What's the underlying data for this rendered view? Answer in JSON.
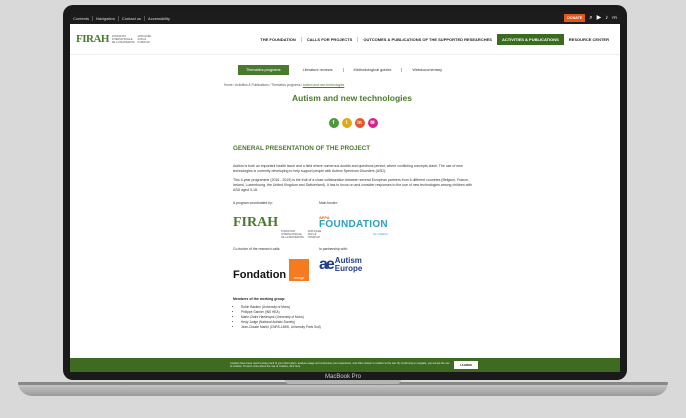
{
  "topbar": {
    "links": [
      "Contents",
      "Navigation",
      "Contact us",
      "Accessibility"
    ],
    "donate": "DONATE",
    "lang": "FR"
  },
  "logo": {
    "mark": "FIRAH",
    "line1": [
      "FONDATION",
      "INTERNATIONALE",
      "DE LA RECHERCHE"
    ],
    "line2": [
      "APPLIQUÉE",
      "SUR LE",
      "HANDICAP"
    ]
  },
  "mainnav": [
    "THE FOUNDATION",
    "CALLS FOR PROJECTS",
    "OUTCOMES & PUBLICATIONS OF THE SUPPORTED RESEARCHES",
    "ACTIVITIES & PUBLICATIONS",
    "RESOURCE CENTER"
  ],
  "subnav": [
    "Thematics programs",
    "Literature reviews",
    "Methodological guides",
    "Webdocumentary"
  ],
  "breadcrumb": {
    "path": "Home / Activities & Publications / Thematics programs / ",
    "current": "Autism and new technologies"
  },
  "title": "Autism and new technologies",
  "share": [
    "f",
    "t",
    "in",
    "✉"
  ],
  "colors": {
    "accent": "#4a7a2e",
    "facebook": "#4c9a3a",
    "twitter": "#e0a81c",
    "linkedin": "#e05a2a",
    "mail": "#d0288a"
  },
  "content": {
    "heading": "GENERAL PRESENTATION OF THE PROJECT",
    "p1": "Autism is both an important health issue and a field where numerous doubts and questions persist, where conflicting concepts clash. The use of new technologies is currently developing to help support people with Autism Spectrum Disorders (ASD).",
    "p2": "This 4-year programme (2016 - 2019) is the fruit of a close collaboration between several European partners from 6 different countries (Belgium, France, Ireland, Luxembourg, the United Kingdom and Switzerland). It has to focus on and consider responses to the use of new technologies among children with ASD aged 3-18.",
    "coordinated": "A program coordinated by:",
    "funder": "Main funder:",
    "cofunder": "Co-funder of the research calls:",
    "partnership": "In partnership with:",
    "afpa": [
      "AFPA",
      "FOUNDATION",
      "for children"
    ],
    "fondation": "Fondation",
    "orange": "orange",
    "autism": [
      "Autism",
      "Europe"
    ],
    "members_title": "Members of the working group:",
    "members": [
      "Robin Bastien (University of Mons)",
      "Philippe Garnier (INS HEA)",
      "Marie-Claire Haelewyck (University of Mons)",
      "Hedy Judge (National Autistic Society)",
      "Jean-Claude Martin (CNRS-LIMSI, University Paris Sud)"
    ]
  },
  "cookie": {
    "text": "Cookies have been used to keep track of your information, analyse usage and customise your experience, and offer content in relation to the site. By continuing to navigate, you accept the use of cookies. To learn more about the use of cookies, click here.",
    "button": "I AGREE"
  },
  "device": "MacBook Pro"
}
